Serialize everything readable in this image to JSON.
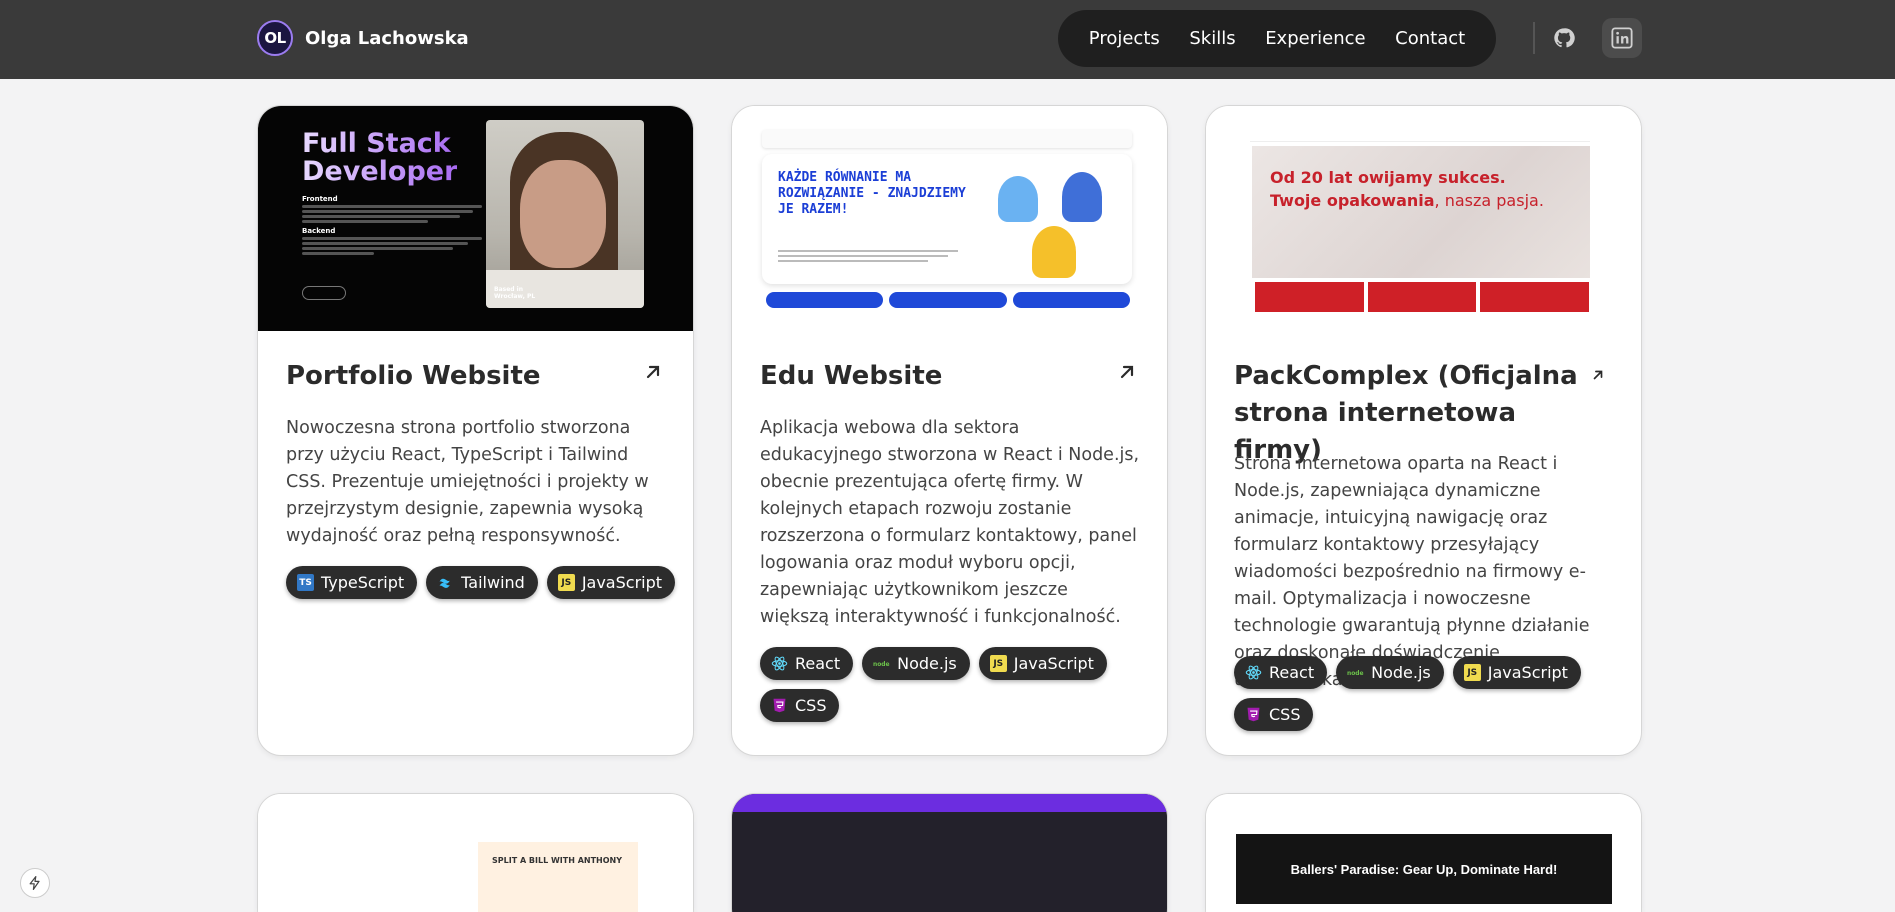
{
  "header": {
    "avatar_initials": "OL",
    "name": "Olga Lachowska",
    "nav": [
      "Projects",
      "Skills",
      "Experience",
      "Contact"
    ]
  },
  "projects": [
    {
      "title": "Portfolio Website",
      "description": "Nowoczesna strona portfolio stworzona przy użyciu React, TypeScript i Tailwind CSS. Prezentuje umiejętności i projekty w przejrzystym designie, zapewnia wysoką wydajność oraz pełną responsywność.",
      "tags": [
        "TypeScript",
        "Tailwind",
        "JavaScript"
      ],
      "thumb": {
        "line1": "Full Stack",
        "line2": "Developer",
        "frontend": "Frontend",
        "backend": "Backend",
        "based": "Based in",
        "city": "Wrocław, PL"
      }
    },
    {
      "title": "Edu Website",
      "description": "Aplikacja webowa dla sektora edukacyjnego stworzona w React i Node.js, obecnie prezentująca ofertę firmy. W kolejnych etapach rozwoju zostanie rozszerzona o formularz kontaktowy, panel logowania oraz moduł wyboru opcji, zapewniając użytkownikom jeszcze większą interaktywność i funkcjonalność.",
      "tags": [
        "React",
        "Node.js",
        "JavaScript",
        "CSS"
      ],
      "thumb": {
        "headline": "KAŻDE RÓWNANIE MA ROZWIĄZANIE - ZNAJDZIEMY JE RAZEM!"
      }
    },
    {
      "title": "PackComplex (Oficjalna strona internetowa firmy)",
      "description": "Strona internetowa oparta na React i Node.js, zapewniająca dynamiczne animacje, intuicyjną nawigację oraz formularz kontaktowy przesyłający wiadomości bezpośrednio na firmowy e-mail. Optymalizacja i nowoczesne technologie gwarantują płynne działanie oraz doskonałe doświadczenie użytkownika.",
      "tags": [
        "React",
        "Node.js",
        "JavaScript",
        "CSS"
      ],
      "thumb": {
        "line1": "Od 20 lat owijamy sukces.",
        "line2a": "Twoje opakowania",
        "line2b": ", nasza pasja."
      }
    }
  ],
  "row2": {
    "split_title": "SPLIT A BILL WITH ANTHONY",
    "ballers_title": "Ballers' Paradise: Gear Up, Dominate Hard!"
  },
  "colors": {
    "header_bg": "#3a3a3a",
    "nav_bg": "#1f1f1f",
    "tag_bg": "#2c2c2c",
    "accent_purple": "#a86af2"
  }
}
